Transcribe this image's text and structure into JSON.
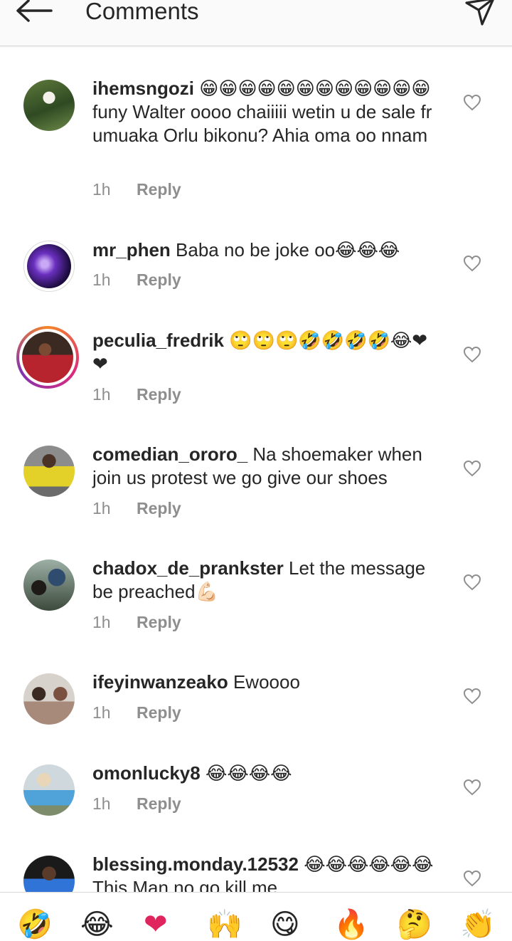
{
  "header": {
    "title": "Comments",
    "back_icon": "arrow-left-icon",
    "send_icon": "send-paper-plane-icon"
  },
  "comments": [
    {
      "username": "ihemsngozi",
      "text": " 😁😁😁😁😁😁😁😁😁😁😁😁funy Walter oooo chaiiiii wetin u de sale fr umuaka Orlu bikonu? Ahia oma oo nnam",
      "time": "1h",
      "reply": "Reply"
    },
    {
      "username": "mr_phen",
      "text": " Baba no be joke oo😂😂😂",
      "time": "1h",
      "reply": "Reply"
    },
    {
      "username": "peculia_fredrik",
      "text": " 🙄🙄🙄🤣🤣🤣🤣😂❤❤",
      "time": "1h",
      "reply": "Reply"
    },
    {
      "username": "comedian_ororo_",
      "text": " Na shoemaker when join us protest we go give our shoes",
      "time": "1h",
      "reply": "Reply"
    },
    {
      "username": "chadox_de_prankster",
      "text": " Let the message be preached💪🏻",
      "time": "1h",
      "reply": "Reply"
    },
    {
      "username": "ifeyinwanzeako",
      "text": " Ewoooo",
      "time": "1h",
      "reply": "Reply"
    },
    {
      "username": "omonlucky8",
      "text": " 😂😂😂😂",
      "time": "1h",
      "reply": "Reply"
    },
    {
      "username": "blessing.monday.12532",
      "text": " 😂😂😂😂😂😂 This Man no go kill me",
      "time": "",
      "reply": ""
    }
  ],
  "emoji_bar": [
    "🤣",
    "😂",
    "❤",
    "🙌",
    "😋",
    "🔥",
    "🤔",
    "👏"
  ],
  "colors": {
    "text": "#262626",
    "meta": "#8e8e8e",
    "story_ring_start": "#f58529",
    "story_ring_end": "#dd2a7b"
  }
}
